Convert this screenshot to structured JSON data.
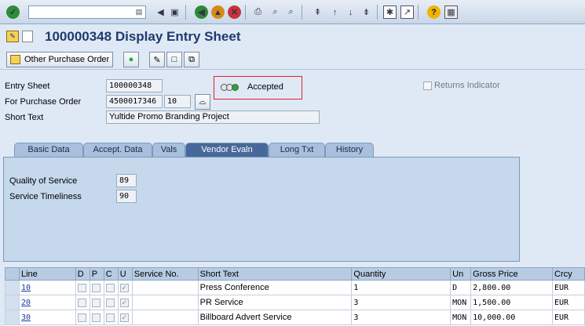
{
  "page_title": "100000348 Display Entry Sheet",
  "toolbar": {
    "other_po_label": "Other Purchase Order"
  },
  "header": {
    "entry_sheet_label": "Entry Sheet",
    "entry_sheet_value": "100000348",
    "status_text": "Accepted",
    "returns_label": "Returns Indicator",
    "po_label": "For Purchase Order",
    "po_value": "4500017346",
    "po_item": "10",
    "short_text_label": "Short Text",
    "short_text_value": "Yultide Promo Branding Project"
  },
  "tabs": [
    {
      "label": "Basic Data"
    },
    {
      "label": "Accept. Data"
    },
    {
      "label": "Vals"
    },
    {
      "label": "Vendor Evaln",
      "active": true
    },
    {
      "label": "Long Txt"
    },
    {
      "label": "History"
    }
  ],
  "vendor_eval": {
    "quality_label": "Quality of Service",
    "quality_value": "89",
    "timeliness_label": "Service Timeliness",
    "timeliness_value": "90"
  },
  "table": {
    "columns": [
      "Line",
      "D",
      "P",
      "C",
      "U",
      "Service No.",
      "Short Text",
      "Quantity",
      "Un",
      "Gross Price",
      "Crcy"
    ],
    "rows": [
      {
        "line": "10",
        "short_text": "Press Conference",
        "quantity": "1",
        "unit": "D",
        "gross_price": "2,800.00",
        "currency": "EUR"
      },
      {
        "line": "20",
        "short_text": "PR Service",
        "quantity": "3",
        "unit": "MON",
        "gross_price": "1,500.00",
        "currency": "EUR"
      },
      {
        "line": "30",
        "short_text": "Billboard Advert Service",
        "quantity": "3",
        "unit": "MON",
        "gross_price": "10,000.00",
        "currency": "EUR"
      }
    ]
  },
  "colors": {
    "title": "#1e3a6e",
    "status_border": "#e0202a",
    "active_tab": "#47689a",
    "panel": "#c5d8ec"
  }
}
